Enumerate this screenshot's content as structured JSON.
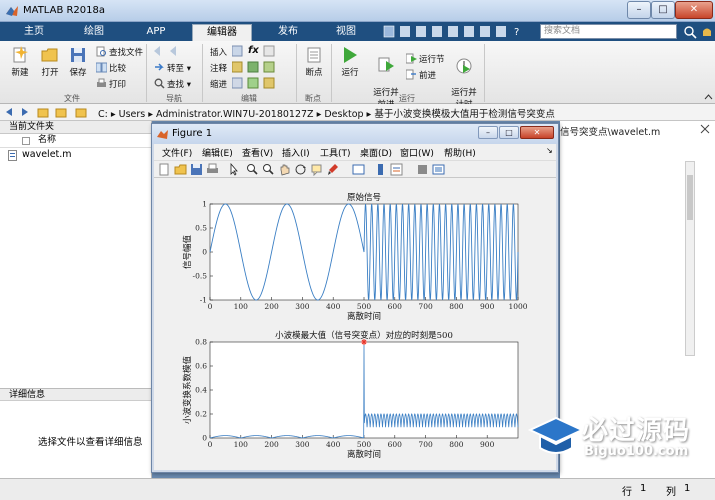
{
  "window": {
    "title": "MATLAB R2018a",
    "min": "–",
    "max": "□",
    "close": "✕"
  },
  "tabs": [
    {
      "label": "主页"
    },
    {
      "label": "绘图"
    },
    {
      "label": "APP"
    },
    {
      "label": "编辑器",
      "active": true
    },
    {
      "label": "发布"
    },
    {
      "label": "视图"
    }
  ],
  "search": {
    "placeholder": "搜索文档"
  },
  "ribbon": {
    "file": {
      "new": "新建",
      "open": "打开",
      "save": "保存",
      "find_files": "查找文件",
      "compare": "比较",
      "print": "打印",
      "group": "文件"
    },
    "nav": {
      "goto": "转至",
      "find": "查找",
      "group": "导航"
    },
    "edit": {
      "insert": "插入",
      "comment": "注释",
      "indent": "缩进",
      "fx": "fx",
      "group": "编辑"
    },
    "breakpoints": {
      "label": "断点",
      "group": "断点"
    },
    "run": {
      "run": "运行",
      "run_advance": "运行并\n前进",
      "run_section": "运行节",
      "advance": "前进",
      "run_time": "运行并\n计时",
      "group": "运行"
    }
  },
  "address": {
    "path": "C: ▸ Users ▸ Administrator.WIN7U-20180127Z ▸ Desktop ▸ 基于小波变换模极大值用于检测信号突变点"
  },
  "current_folder": {
    "header": "当前文件夹",
    "col_name": "名称",
    "files": [
      "wavelet.m"
    ]
  },
  "details": {
    "header": "详细信息",
    "message": "选择文件以查看详细信息"
  },
  "editor": {
    "tab_label": "信号突变点\\wavelet.m"
  },
  "status": {
    "row_label": "行",
    "row_value": "1",
    "col_label": "列",
    "col_value": "1"
  },
  "figure": {
    "title": "Figure 1",
    "menu": [
      "文件(F)",
      "编辑(E)",
      "查看(V)",
      "插入(I)",
      "工具(T)",
      "桌面(D)",
      "窗口(W)",
      "帮助(H)"
    ]
  },
  "watermark": {
    "brand": "必过源码",
    "url": "Biguo100.com"
  },
  "chart_data": [
    {
      "type": "line",
      "title": "原始信号",
      "xlabel": "离散时间",
      "ylabel": "信号幅值",
      "xlim": [
        0,
        1000
      ],
      "ylim": [
        -1,
        1
      ],
      "xticks": [
        0,
        100,
        200,
        300,
        400,
        500,
        600,
        700,
        800,
        900,
        1000
      ],
      "yticks": [
        -1,
        -0.5,
        0,
        0.5,
        1
      ],
      "series": [
        {
          "segment": "low",
          "x_range": [
            0,
            500
          ],
          "period": 200,
          "amplitude": 1
        },
        {
          "segment": "high",
          "x_range": [
            500,
            1000
          ],
          "period": 20,
          "amplitude": 1
        }
      ],
      "color": "#3b7fc4"
    },
    {
      "type": "line",
      "title": "小波模最大值（信号突变点）对应的时刻是500",
      "xlabel": "离散时间",
      "ylabel": "小波变换系数模值",
      "xlim": [
        0,
        1000
      ],
      "ylim": [
        0,
        0.8
      ],
      "xticks": [
        0,
        100,
        200,
        300,
        400,
        500,
        600,
        700,
        800,
        900
      ],
      "yticks": [
        0,
        0.2,
        0.4,
        0.6,
        0.8
      ],
      "peak": {
        "x": 500,
        "y": 0.8
      },
      "low_level": 0.02,
      "high_level": 0.2,
      "color": "#3b7fc4",
      "marker_color": "#e8352a"
    }
  ]
}
